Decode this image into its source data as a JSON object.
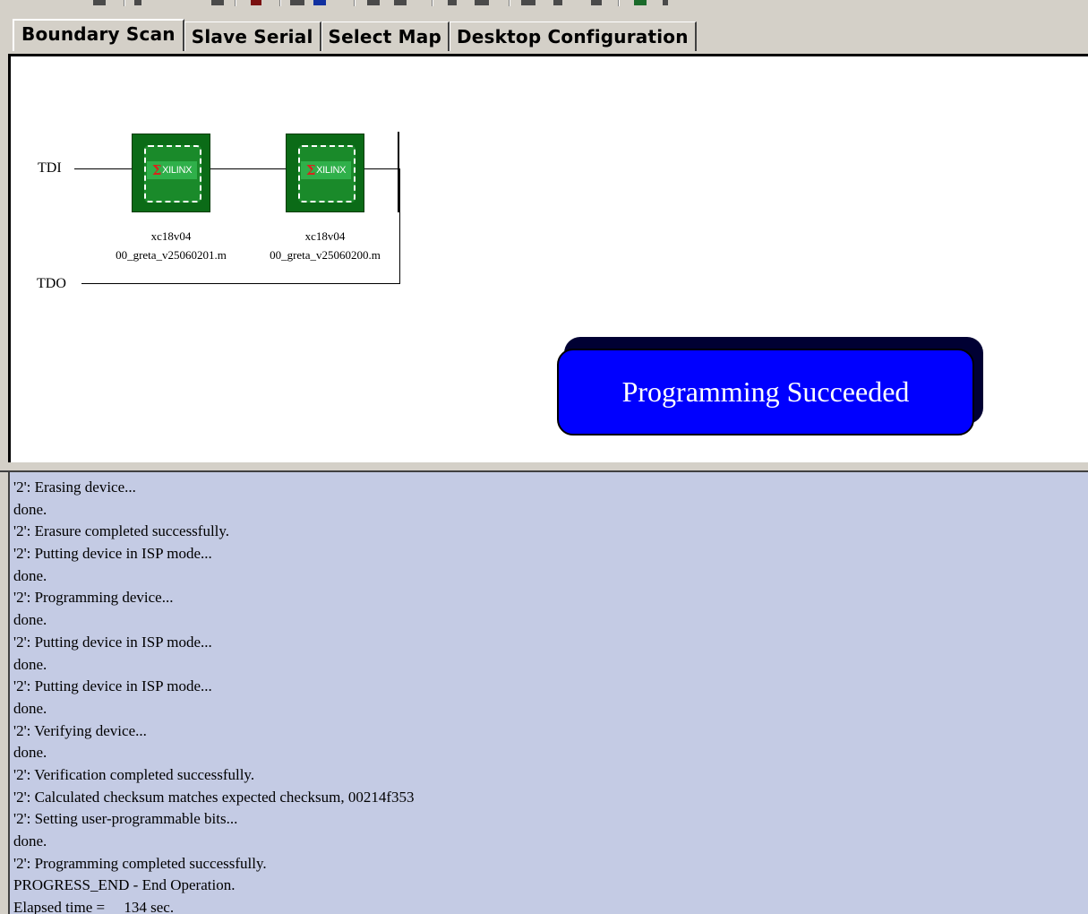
{
  "window": {
    "accent_color": "#0000ff",
    "log_background": "#c4cbe4"
  },
  "tabs": [
    {
      "label": "Boundary Scan",
      "active": true
    },
    {
      "label": "Slave Serial",
      "active": false
    },
    {
      "label": "Select Map",
      "active": false
    },
    {
      "label": "Desktop Configuration",
      "active": false
    }
  ],
  "scan_chain": {
    "tdi_label": "TDI",
    "tdo_label": "TDO",
    "devices": [
      {
        "part": "xc18v04",
        "file": "00_greta_v25060201.m",
        "logo_text": "XILINX",
        "icon": "xilinx-chip-icon"
      },
      {
        "part": "xc18v04",
        "file": "00_greta_v25060200.m",
        "logo_text": "XILINX",
        "icon": "xilinx-chip-icon"
      }
    ]
  },
  "status_banner": {
    "text": "Programming Succeeded"
  },
  "log": {
    "lines": [
      "'2': Erasing device...",
      "done.",
      "'2': Erasure completed successfully.",
      "'2': Putting device in ISP mode...",
      "done.",
      "'2': Programming device...",
      "done.",
      "'2': Putting device in ISP mode...",
      "done.",
      "'2': Putting device in ISP mode...",
      "done.",
      "'2': Verifying device...",
      "done.",
      "'2': Verification completed successfully.",
      "'2': Calculated checksum matches expected checksum, 00214f353",
      "'2': Setting user-programmable bits...",
      "done.",
      "'2': Programming completed successfully.",
      "PROGRESS_END - End Operation.",
      "Elapsed time =     134 sec."
    ]
  }
}
